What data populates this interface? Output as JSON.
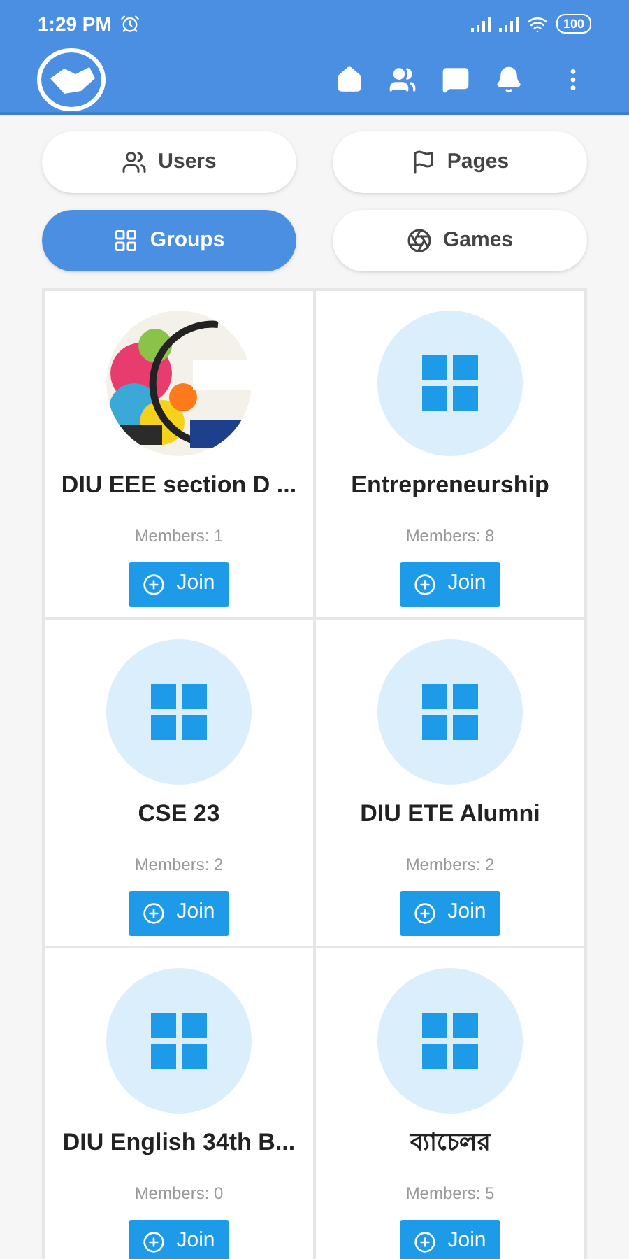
{
  "status_bar": {
    "time": "1:29 PM",
    "battery": "100"
  },
  "tabs": [
    {
      "label": "Users",
      "kind": "users",
      "selected": false
    },
    {
      "label": "Pages",
      "kind": "flag",
      "selected": false
    },
    {
      "label": "Groups",
      "kind": "grid",
      "selected": true
    },
    {
      "label": "Games",
      "kind": "games",
      "selected": false
    }
  ],
  "groups": [
    {
      "name": "DIU EEE section D ...",
      "members": "Members: 1",
      "button": "Join"
    },
    {
      "name": "Entrepreneurship",
      "members": "Members: 8",
      "button": "Join",
      "avatar": {
        "kind": "icon"
      }
    },
    {
      "name": "CSE 23",
      "members": "Members: 2",
      "button": "Join",
      "avatar": {
        "kind": "icon"
      }
    },
    {
      "name": "DIU ETE Alumni",
      "members": "Members: 2",
      "button": "Join",
      "avatar": {
        "kind": "icon"
      }
    },
    {
      "name": "DIU English 34th B...",
      "members": "Members: 0",
      "button": "Join",
      "avatar": {
        "kind": "icon"
      }
    },
    {
      "name": "ব্যাচেলর",
      "members": "Members: 5",
      "button": "Join",
      "avatar": {
        "kind": "icon"
      }
    }
  ]
}
